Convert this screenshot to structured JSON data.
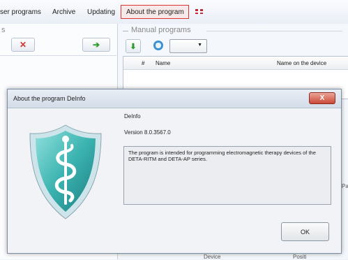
{
  "menu": {
    "items": [
      "ser programs",
      "Archive",
      "Updating",
      "About the program"
    ],
    "flag_icon": "uk-flag-icon"
  },
  "left_panel": {
    "title": "s",
    "delete_icon": "red-x-icon",
    "add_icon": "green-arrow-right-icon"
  },
  "right_panel": {
    "title": "Manual programs",
    "download_icon": "green-arrow-down-icon",
    "clock_icon": "clock-icon",
    "dropdown_icon": "chevron-down-icon",
    "columns": [
      "#",
      "Name",
      "Name on the device"
    ]
  },
  "dialog": {
    "title": "About the program DeInfo",
    "close_label": "X",
    "app_name": "DeInfo",
    "version": "Version 8.0.3567.0",
    "description": "The program is intended for programming electromagnetic therapy devices of the DETA-RITM and DETA-AP series.",
    "ok_label": "OK",
    "logo_icon": "caduceus-shield-icon"
  },
  "background_fragments": {
    "right_edge": "Pa",
    "bottom_1": "Device",
    "bottom_2": "Positi"
  }
}
